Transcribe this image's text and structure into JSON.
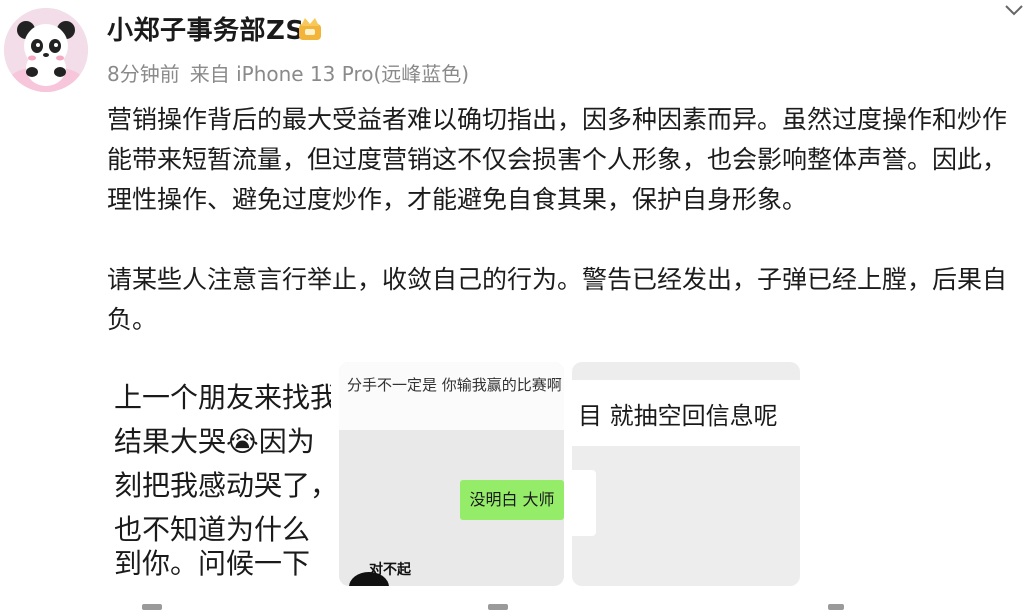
{
  "post": {
    "username": "小郑子事务部ZS",
    "time": "8分钟前",
    "source": "来自 iPhone 13 Pro(远峰蓝色)",
    "paragraphs": [
      "营销操作背后的最大受益者难以确切指出，因多种因素而异。虽然过度操作和炒作",
      "能带来短暂流量，但过度营销这不仅会损害个人形象，也会影响整体声誉。因此，",
      "理性操作、避免过度炒作，才能避免自食其果，保护自身形象。",
      "请某些人注意言行举止，收敛自己的行为。警告已经发出，子弹已经上膛，后果自",
      "负。"
    ]
  },
  "images": {
    "one": {
      "lines": [
        "上一个朋友来找我",
        "结果大哭",
        "因为",
        "刻把我感动哭了，",
        "也不知道为什么",
        "到你。问候一下"
      ],
      "emoji": "😭"
    },
    "two": {
      "top_text": "分手不一定是 你输我赢的比赛啊",
      "bubble": "没明白 大师",
      "sticker": "对不起"
    },
    "three": {
      "text": "目 就抽空回信息呢"
    }
  },
  "colors": {
    "bubble_green": "#95ec69",
    "meta_gray": "#8a8a8a",
    "badge_gold": "#f2b43a"
  },
  "icons": {
    "vip": "vip-crown-icon",
    "collapse": "chevron-down-icon"
  }
}
